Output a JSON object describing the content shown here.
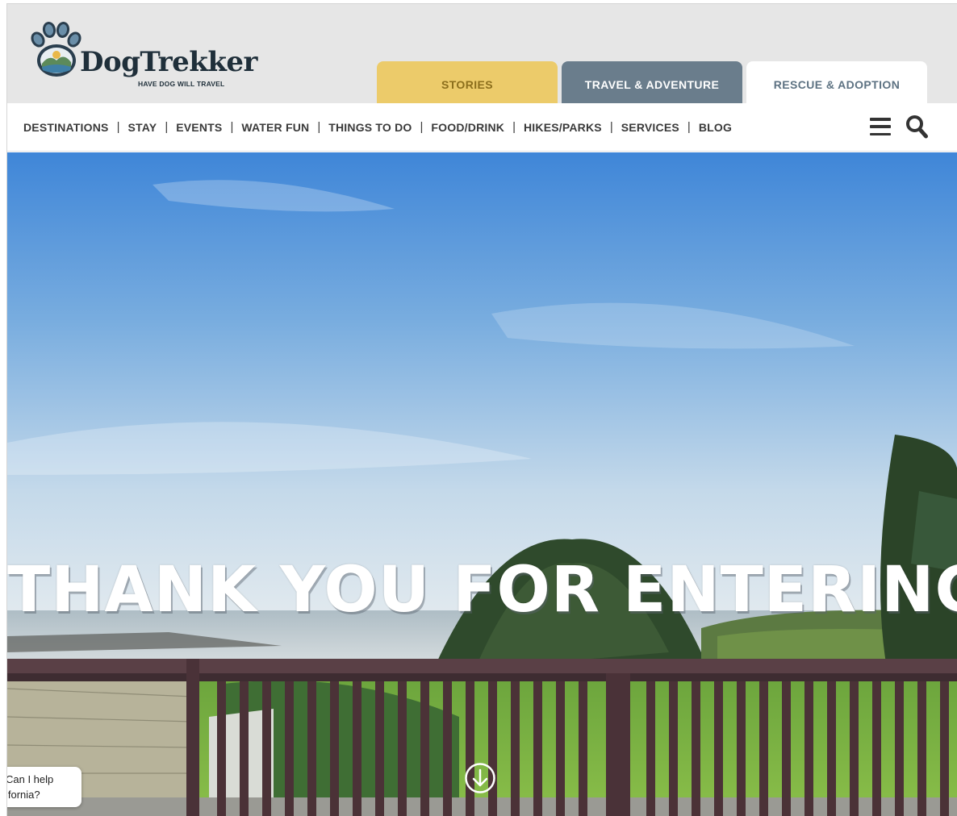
{
  "brand": {
    "name": "DogTrekker",
    "tagline": "HAVE DOG WILL TRAVEL"
  },
  "tabs": [
    {
      "label": "STORIES"
    },
    {
      "label": "TRAVEL & ADVENTURE"
    },
    {
      "label": "RESCUE & ADOPTION"
    }
  ],
  "nav": {
    "items": [
      "DESTINATIONS",
      "STAY",
      "EVENTS",
      "WATER FUN",
      "THINGS TO DO",
      "FOOD/DRINK",
      "HIKES/PARKS",
      "SERVICES",
      "BLOG"
    ],
    "separator": "|"
  },
  "icons": {
    "menu": "hamburger-menu-icon",
    "search": "search-icon",
    "scroll": "arrow-down-circle-icon",
    "logo": "paw-print-logo-icon"
  },
  "hero": {
    "title": "THANK YOU FOR ENTERING!"
  },
  "chat": {
    "line1": "Can I help",
    "line2": "ifornia?"
  },
  "colors": {
    "stories_tab": "#eccb6a",
    "travel_tab": "#6a7d8c",
    "rescue_tab": "#ffffff",
    "header_bg": "#e6e6e6"
  }
}
